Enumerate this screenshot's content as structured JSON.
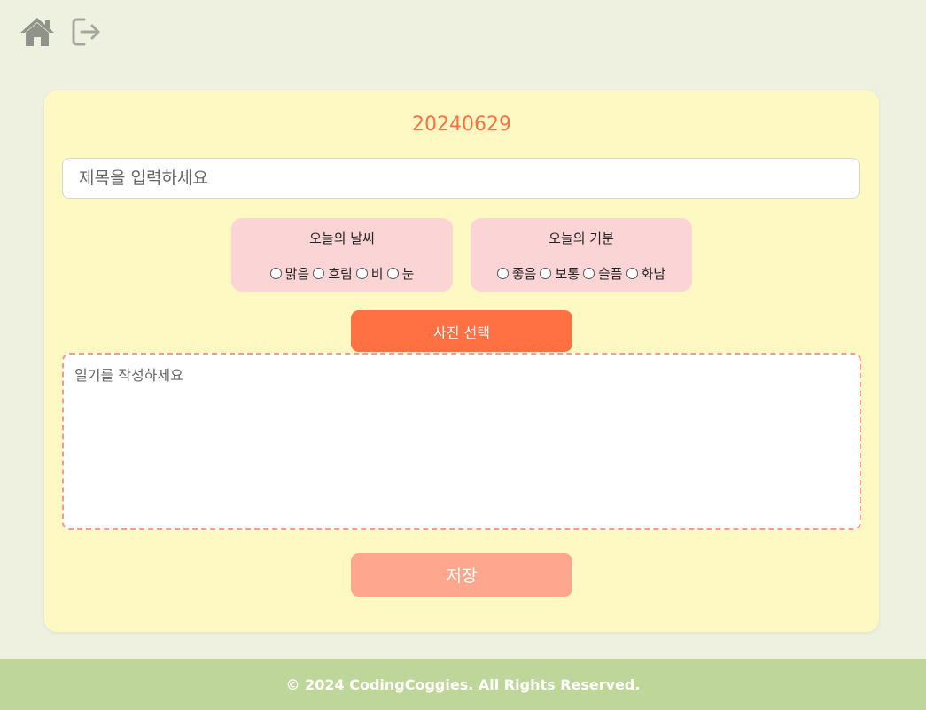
{
  "nav": {
    "home_icon": "home-icon",
    "logout_icon": "logout-icon"
  },
  "diary": {
    "date": "20240629",
    "title_placeholder": "제목을 입력하세요",
    "weather": {
      "title": "오늘의 날씨",
      "options": [
        "맑음",
        "흐림",
        "비",
        "눈"
      ]
    },
    "mood": {
      "title": "오늘의 기분",
      "options": [
        "좋음",
        "보통",
        "슬픔",
        "화남"
      ]
    },
    "photo_button_label": "사진 선택",
    "content_placeholder": "일기를 작성하세요",
    "save_button_label": "저장"
  },
  "footer": {
    "text": "© 2024 CodingCoggies. All Rights Reserved."
  },
  "colors": {
    "accent": "#ff7043",
    "save_button": "#ffa78e",
    "card_bg": "#fef9c3",
    "option_bg": "#fbd5d5",
    "footer_bg": "#bfd69a",
    "page_bg": "#eff1e0"
  }
}
